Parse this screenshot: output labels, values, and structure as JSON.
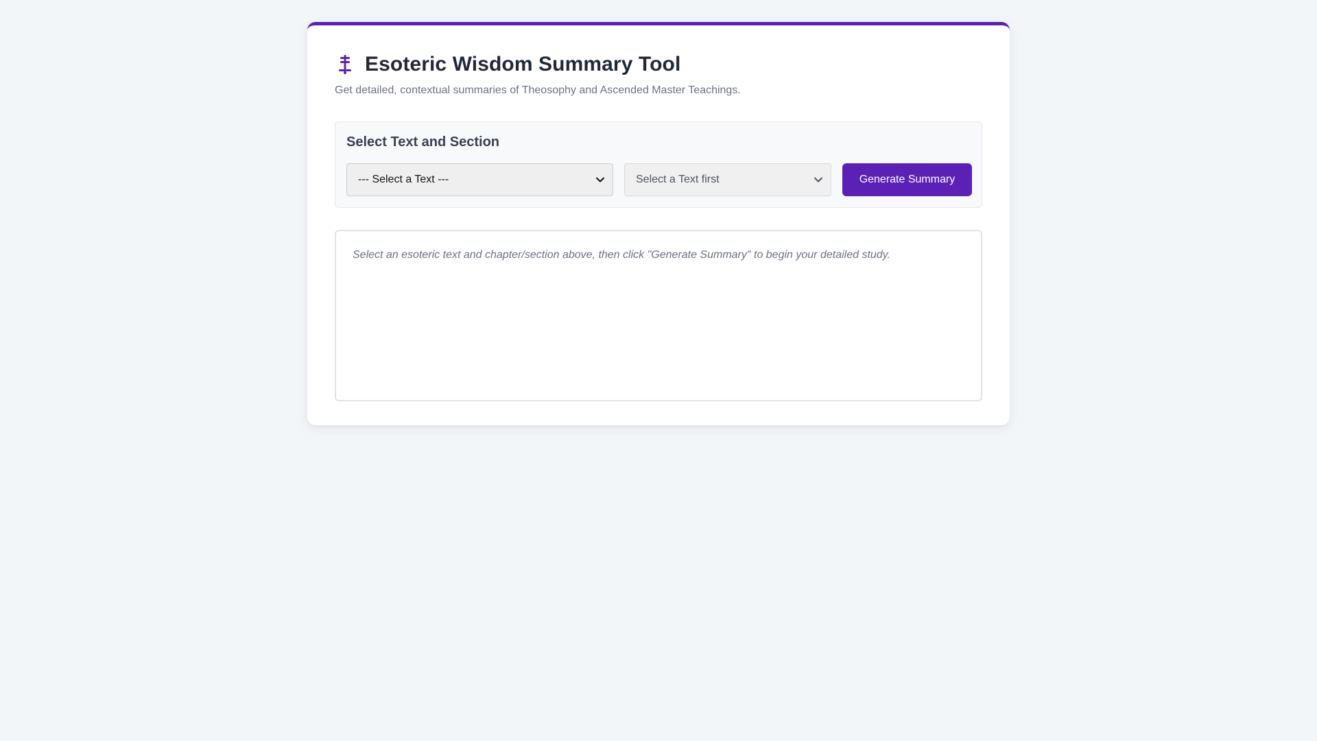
{
  "header": {
    "icon": "scroll-icon",
    "title": "Esoteric Wisdom Summary Tool",
    "subtitle": "Get detailed, contextual summaries of Theosophy and Ascended Master Teachings."
  },
  "selection_panel": {
    "title": "Select Text and Section",
    "text_select": {
      "selected": "--- Select a Text ---"
    },
    "section_select": {
      "selected": "Select a Text first"
    },
    "generate_button": "Generate Summary"
  },
  "output": {
    "placeholder": "Select an esoteric text and chapter/section above, then click \"Generate Summary\" to begin your detailed study."
  },
  "colors": {
    "accent": "#5b21b6",
    "background": "#f3f6f9",
    "muted_text": "#6b7280"
  }
}
